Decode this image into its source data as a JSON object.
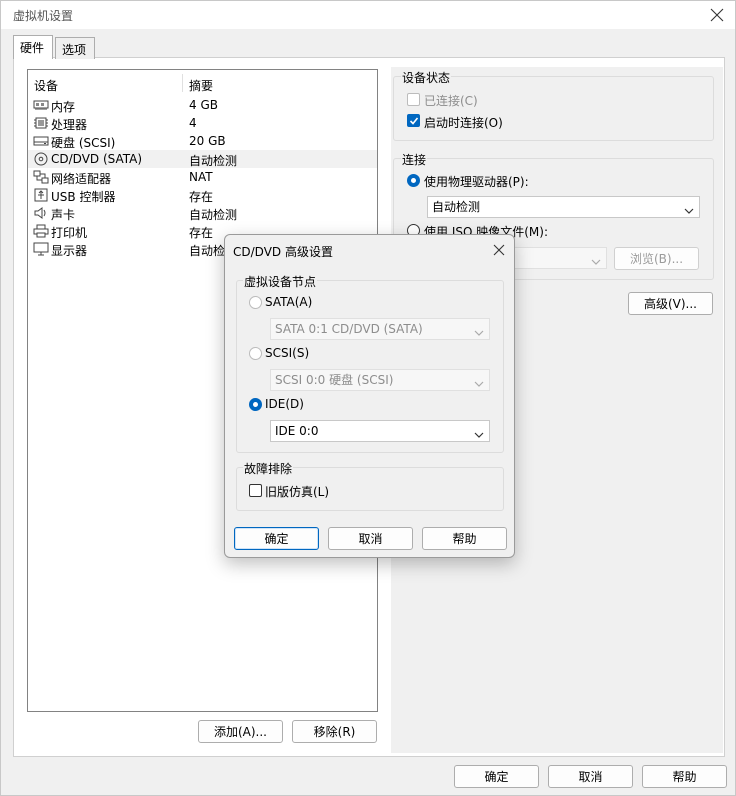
{
  "window": {
    "title": "虚拟机设置"
  },
  "tabs": [
    {
      "label": "硬件",
      "active": true
    },
    {
      "label": "选项",
      "active": false
    }
  ],
  "device_list": {
    "headers": {
      "device": "设备",
      "summary": "摘要"
    },
    "rows": [
      {
        "icon": "memory-icon",
        "name": "内存",
        "summary": "4 GB"
      },
      {
        "icon": "processor-icon",
        "name": "处理器",
        "summary": "4"
      },
      {
        "icon": "hard-disk-icon",
        "name": "硬盘 (SCSI)",
        "summary": "20 GB"
      },
      {
        "icon": "cd-dvd-icon",
        "name": "CD/DVD (SATA)",
        "summary": "自动检测",
        "selected": true
      },
      {
        "icon": "network-adapter-icon",
        "name": "网络适配器",
        "summary": "NAT"
      },
      {
        "icon": "usb-icon",
        "name": "USB 控制器",
        "summary": "存在"
      },
      {
        "icon": "sound-card-icon",
        "name": "声卡",
        "summary": "自动检测"
      },
      {
        "icon": "printer-icon",
        "name": "打印机",
        "summary": "存在"
      },
      {
        "icon": "display-icon",
        "name": "显示器",
        "summary": "自动检测"
      }
    ]
  },
  "list_buttons": {
    "add": "添加(A)...",
    "remove": "移除(R)"
  },
  "device_status": {
    "label": "设备状态",
    "connected": "已连接(C)",
    "connect_at_power_on": "启动时连接(O)"
  },
  "connection": {
    "label": "连接",
    "use_physical": "使用物理驱动器(P):",
    "physical_value": "自动检测",
    "use_iso": "使用 ISO 映像文件(M):",
    "iso_value": "",
    "browse": "浏览(B)..."
  },
  "advanced_button": "高级(V)...",
  "footer": {
    "ok": "确定",
    "cancel": "取消",
    "help": "帮助"
  },
  "dialog": {
    "title": "CD/DVD 高级设置",
    "node_group": "虚拟设备节点",
    "sata_label": "SATA(A)",
    "sata_value": "SATA 0:1   CD/DVD (SATA)",
    "scsi_label": "SCSI(S)",
    "scsi_value": "SCSI 0:0   硬盘 (SCSI)",
    "ide_label": "IDE(D)",
    "ide_value": "IDE 0:0",
    "trouble_group": "故障排除",
    "legacy": "旧版仿真(L)",
    "ok": "确定",
    "cancel": "取消",
    "help": "帮助"
  },
  "colors": {
    "accent": "#0067c0",
    "selected_row": "#f1f1f1"
  }
}
